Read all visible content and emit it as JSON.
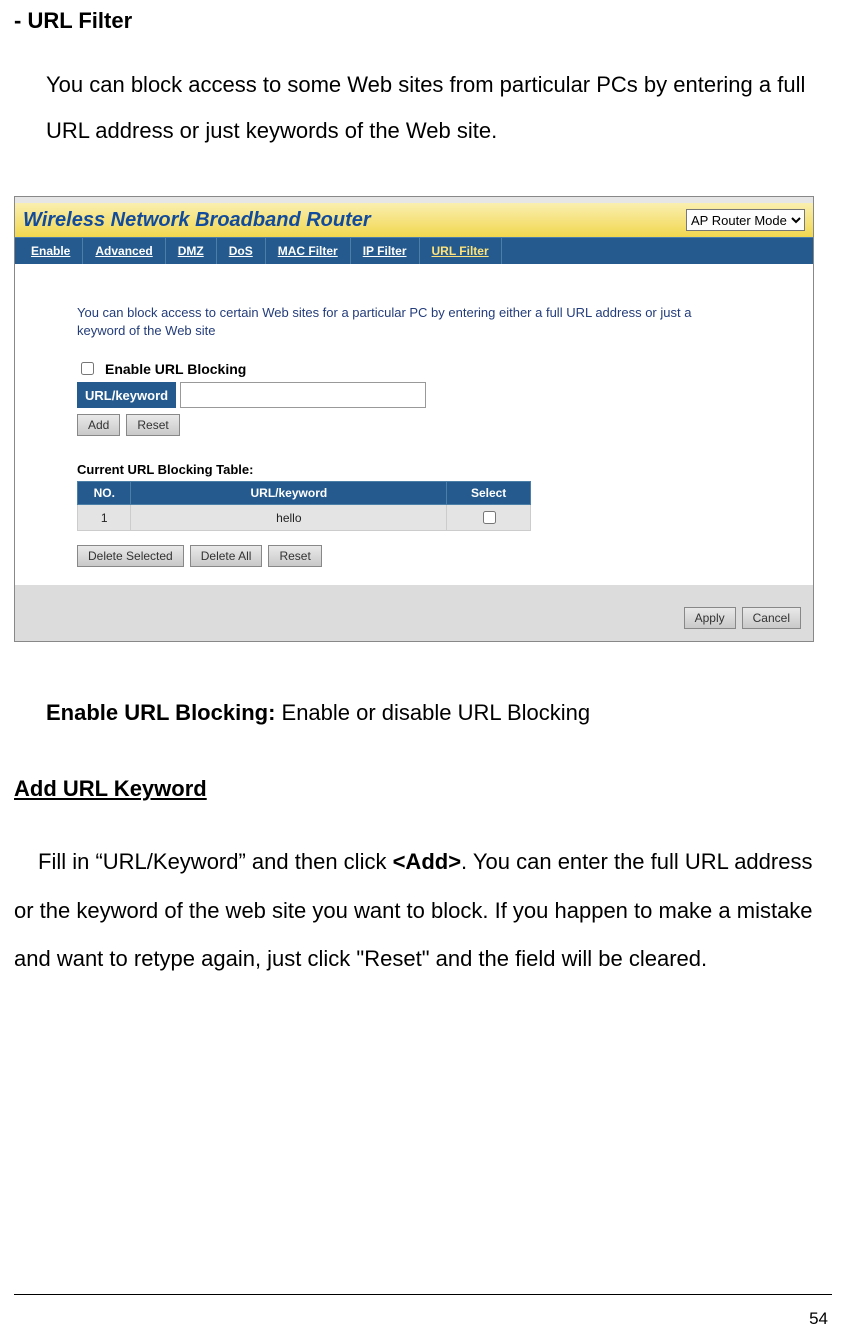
{
  "doc": {
    "title": "- URL Filter",
    "intro": "You can block access to some Web sites from particular PCs by entering a full URL address or just keywords of the Web site.",
    "enable_line_bold": "Enable URL Blocking:",
    "enable_line_rest": " Enable or disable URL Blocking",
    "sub_heading": "Add URL Keyword",
    "body_before_add": "Fill in “URL/Keyword” and then click ",
    "add_bold": "<Add>",
    "body_after_add": ". You can enter the full URL address or the keyword of the web site you want to block. If you happen to make a mistake and want to retype again, just click \"Reset\" and the field will be cleared.",
    "page_number": "54"
  },
  "screenshot": {
    "brand": "Wireless Network Broadband Router",
    "mode_selected": "AP Router Mode",
    "tabs": [
      "Enable",
      "Advanced",
      "DMZ",
      "DoS",
      "MAC Filter",
      "IP Filter",
      "URL Filter"
    ],
    "active_tab_index": 6,
    "desc": "You can block access to certain Web sites for a particular PC by entering either a full URL address or just a keyword of the Web site",
    "enable_checkbox_label": "Enable URL Blocking",
    "input_label": "URL/keyword",
    "add_btn": "Add",
    "reset_btn": "Reset",
    "table_title": "Current URL Blocking Table:",
    "th_no": "NO.",
    "th_url": "URL/keyword",
    "th_select": "Select",
    "row_no": "1",
    "row_url": "hello",
    "delete_selected_btn": "Delete Selected",
    "delete_all_btn": "Delete All",
    "table_reset_btn": "Reset",
    "apply_btn": "Apply",
    "cancel_btn": "Cancel"
  }
}
